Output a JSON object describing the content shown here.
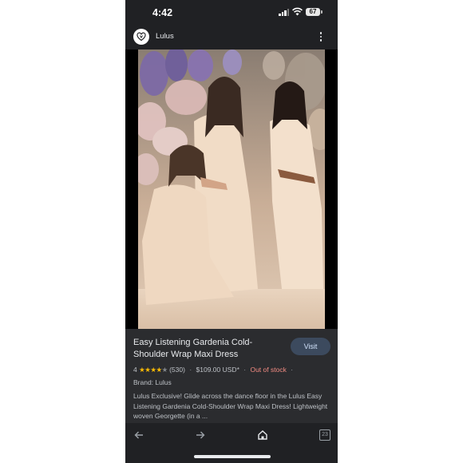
{
  "status_bar": {
    "time": "4:42",
    "battery": "67"
  },
  "header": {
    "site_name": "Lulus"
  },
  "product": {
    "title": "Easy Listening Gardenia Cold-Shoulder Wrap Maxi Dress",
    "visit_label": "Visit",
    "rating": "4",
    "stars_icon": "star-rating-icon",
    "stars_fraction": 0.8,
    "review_count": "(530)",
    "price": "$109.00 USD*",
    "stock_status": "Out of stock",
    "brand": "Brand: Lulus",
    "description": "Lulus Exclusive! Glide across the dance floor in the Lulus Easy Listening Gardenia Cold-Shoulder Wrap Maxi Dress! Lightweight woven Georgette (in a ..."
  },
  "toolbar": {
    "tab_count": "23"
  },
  "colors": {
    "background": "#202124",
    "card": "#2b2c2f",
    "accent_star": "#fbbc04",
    "out_of_stock": "#f28b82",
    "visit_button": "#3c4a5e"
  }
}
